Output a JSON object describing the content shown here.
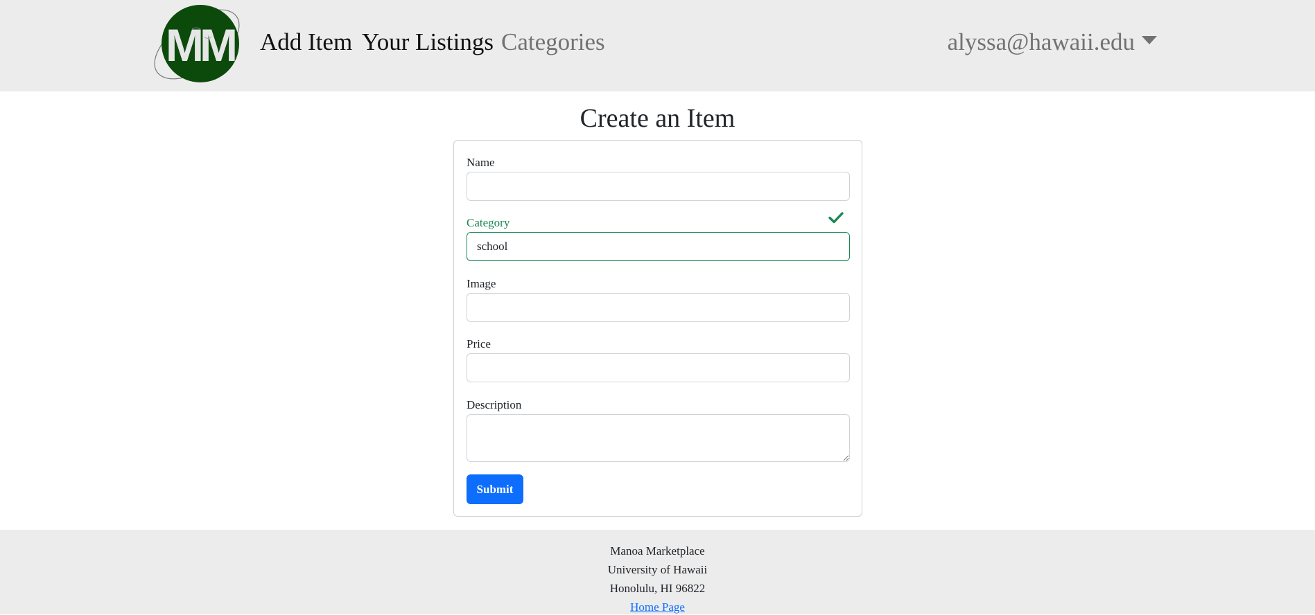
{
  "navbar": {
    "logo_icon": "manoa-marketplace-logo",
    "logo_letters": "MM",
    "links": [
      {
        "label": "Add Item",
        "state": "active"
      },
      {
        "label": "Your Listings",
        "state": "active"
      },
      {
        "label": "Categories",
        "state": "muted"
      }
    ],
    "user_email": "alyssa@hawaii.edu",
    "user_menu_icon": "caret-down-icon"
  },
  "page": {
    "title": "Create an Item"
  },
  "form": {
    "fields": {
      "name": {
        "label": "Name",
        "value": ""
      },
      "category": {
        "label": "Category",
        "value": "school",
        "status": "valid",
        "status_icon": "checkmark-icon"
      },
      "image": {
        "label": "Image",
        "value": ""
      },
      "price": {
        "label": "Price",
        "value": ""
      },
      "description": {
        "label": "Description",
        "value": ""
      }
    },
    "submit_label": "Submit"
  },
  "footer": {
    "lines": [
      "Manoa Marketplace",
      "University of Hawaii",
      "Honolulu, HI 96822"
    ],
    "link_label": "Home Page"
  },
  "colors": {
    "navbar_bg": "#ececec",
    "logo_green": "#0b4a0b",
    "valid_green": "#198754",
    "primary_blue": "#0d6efd",
    "muted_text": "#727272"
  }
}
